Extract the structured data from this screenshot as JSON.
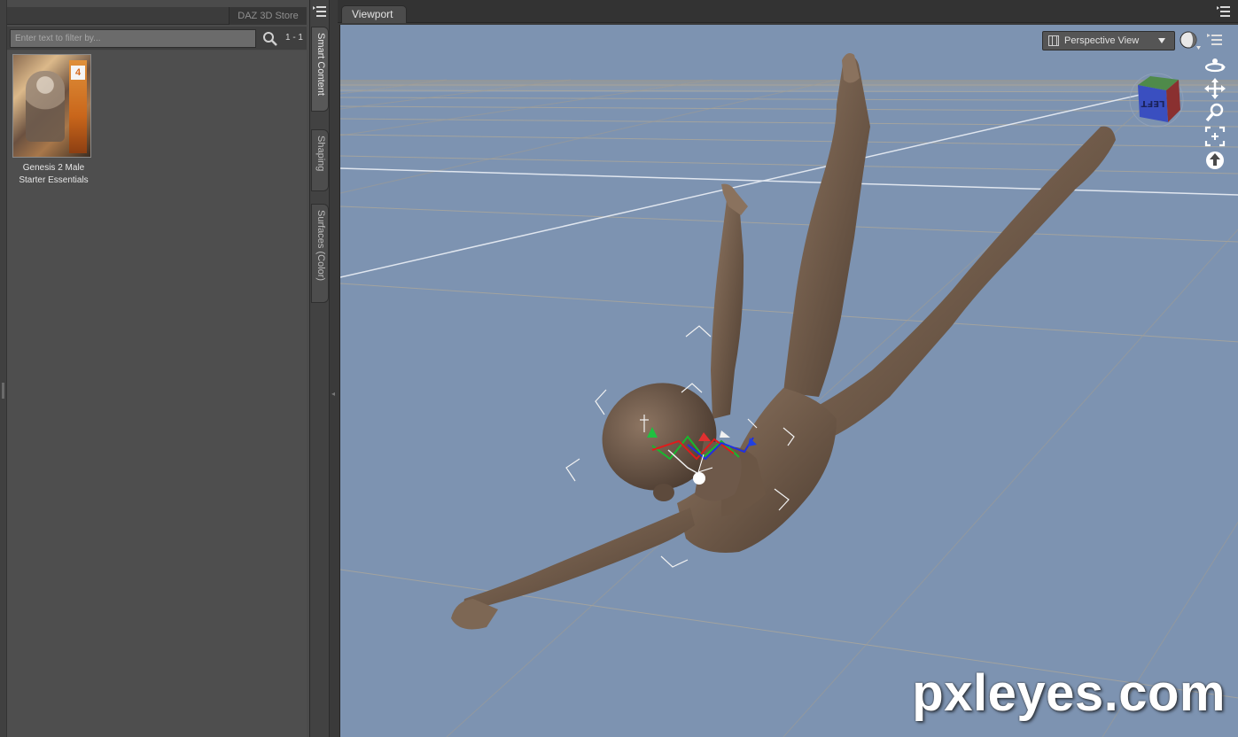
{
  "left_panel": {
    "store_tab": "DAZ 3D Store",
    "filter_placeholder": "Enter text to filter by...",
    "filter_value": "",
    "result_count": "1 - 1",
    "products": [
      {
        "title": "Genesis 2 Male Starter Essentials",
        "badge": "4"
      }
    ]
  },
  "tab_strip": {
    "tabs": [
      {
        "label": "Smart Content",
        "active": true
      },
      {
        "label": "Shaping",
        "active": false
      },
      {
        "label": "Surfaces (Color)",
        "active": false
      }
    ]
  },
  "viewport": {
    "tab_label": "Viewport",
    "camera_view": "Perspective View",
    "nav_cube_label": "LEFT",
    "background_color": "#7d93b1",
    "watermark": "pxleyes.com"
  }
}
